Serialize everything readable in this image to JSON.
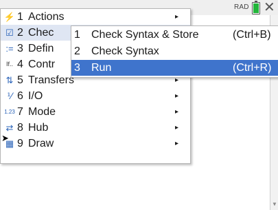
{
  "status": {
    "angle_mode": "RAD",
    "battery_color": "#22b53a",
    "close_glyph": "✕"
  },
  "menu": {
    "items": [
      {
        "icon": "⚡",
        "num": "1",
        "label": "Actions",
        "arrow": "▸"
      },
      {
        "icon": "☑",
        "num": "2",
        "label": "Chec",
        "arrow": ""
      },
      {
        "icon": ":=",
        "num": "3",
        "label": "Defin",
        "arrow": ""
      },
      {
        "icon": "If..",
        "num": "4",
        "label": "Contr",
        "arrow": ""
      },
      {
        "icon": "⇅",
        "num": "5",
        "label": "Transfers",
        "arrow": "▸"
      },
      {
        "icon": "⅟",
        "num": "6",
        "label": "I/O",
        "arrow": "▸"
      },
      {
        "icon": "1.23",
        "num": "7",
        "label": "Mode",
        "arrow": "▸"
      },
      {
        "icon": "⇄",
        "num": "8",
        "label": "Hub",
        "arrow": "▸"
      },
      {
        "icon": "▦",
        "num": "9",
        "label": "Draw",
        "arrow": "▸"
      }
    ]
  },
  "submenu": {
    "items": [
      {
        "num": "1",
        "label": "Check Syntax & Store",
        "shortcut": "(Ctrl+B)"
      },
      {
        "num": "2",
        "label": "Check Syntax",
        "shortcut": ""
      },
      {
        "num": "3",
        "label": "Run",
        "shortcut": "(Ctrl+R)"
      }
    ],
    "highlight_color": "#3f74cc"
  }
}
